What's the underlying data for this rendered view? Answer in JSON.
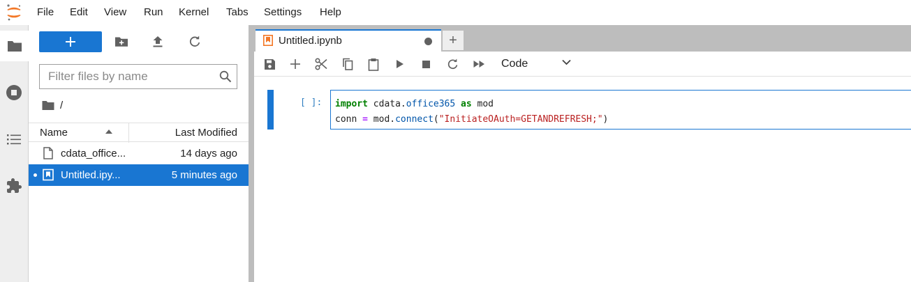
{
  "menubar": {
    "items": [
      "File",
      "Edit",
      "View",
      "Run",
      "Kernel",
      "Tabs",
      "Settings",
      "Help"
    ]
  },
  "activitybar": {
    "tabs": [
      "folder-icon",
      "running-icon",
      "toc-icon",
      "extension-icon"
    ]
  },
  "filebrowser": {
    "new_button_icon": "plus-icon",
    "toolbar_icons": [
      "new-folder-icon",
      "upload-icon",
      "refresh-icon"
    ],
    "filter_placeholder": "Filter files by name",
    "breadcrumb_path": "/",
    "columns": {
      "name": "Name",
      "modified": "Last Modified"
    },
    "rows": [
      {
        "name": "cdata_office...",
        "modified": "14 days ago",
        "type": "file",
        "selected": false,
        "running": false
      },
      {
        "name": "Untitled.ipy...",
        "modified": "5 minutes ago",
        "type": "notebook",
        "selected": true,
        "running": true
      }
    ]
  },
  "main": {
    "tab": {
      "title": "Untitled.ipynb",
      "modified": true
    },
    "add_tab_label": "+",
    "toolbar": {
      "icons": [
        "save-icon",
        "add-cell-icon",
        "cut-icon",
        "copy-icon",
        "paste-icon",
        "run-icon",
        "stop-icon",
        "restart-icon",
        "run-all-icon"
      ],
      "cell_type": "Code"
    },
    "cell": {
      "prompt": "[ ]:",
      "code_line1": {
        "kw1": "import",
        "mod": " cdata.",
        "attr": "office365",
        "sp": " ",
        "kw2": "as",
        "alias": " mod"
      },
      "code_line2": {
        "lhs": "conn ",
        "eq": "=",
        "call": " mod.",
        "fn": "connect",
        "open": "(",
        "str": "\"InitiateOAuth=GETANDREFRESH;\"",
        "close": ")"
      }
    }
  },
  "colors": {
    "accent": "#1976d2",
    "activity_bg": "#eeeeee",
    "tabbar_bg": "#bdbdbd",
    "keyword": "#008000",
    "string": "#ba2121",
    "operator": "#aa22ff",
    "prompt": "#307fc1"
  }
}
